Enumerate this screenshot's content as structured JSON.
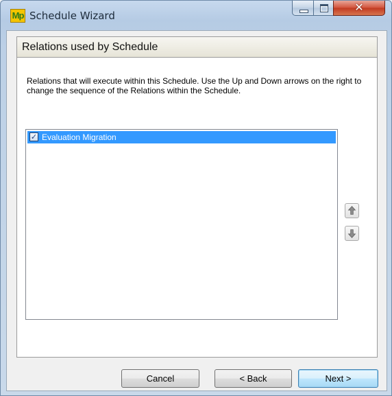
{
  "window": {
    "title": "Schedule Wizard",
    "icon_text": "Mp",
    "close_glyph": "✕"
  },
  "header": {
    "title": "Relations used by Schedule"
  },
  "description": "Relations that will execute within this Schedule. Use the Up and Down arrows on the right to change the sequence of the Relations within the Schedule.",
  "relations": [
    {
      "label": "Evaluation Migration",
      "checked": true,
      "selected": true,
      "check_glyph": "✓"
    }
  ],
  "buttons": {
    "cancel": "Cancel",
    "back": "< Back",
    "next": "Next >"
  },
  "colors": {
    "selection": "#3399ff",
    "default_button_border": "#3c7fb1",
    "close_button": "#c13a22"
  },
  "icons": [
    "app-logo-icon",
    "minimize-icon",
    "maximize-icon",
    "close-icon",
    "move-up-arrow-icon",
    "move-down-arrow-icon",
    "checkbox-checked-icon"
  ]
}
